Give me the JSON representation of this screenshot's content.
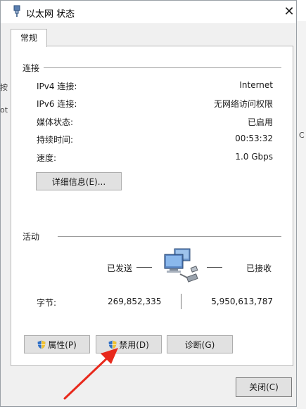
{
  "window": {
    "title": "以太网 状态",
    "close_glyph": "✕"
  },
  "tabs": [
    {
      "label": "常规"
    }
  ],
  "connection": {
    "heading": "连接",
    "rows": [
      {
        "label": "IPv4 连接:",
        "value": "Internet"
      },
      {
        "label": "IPv6 连接:",
        "value": "无网络访问权限"
      },
      {
        "label": "媒体状态:",
        "value": "已启用"
      },
      {
        "label": "持续时间:",
        "value": "00:53:32"
      },
      {
        "label": "速度:",
        "value": "1.0 Gbps"
      }
    ],
    "details_button": "详细信息(E)..."
  },
  "activity": {
    "heading": "活动",
    "sent_label": "已发送",
    "received_label": "已接收",
    "bytes_label": "字节:",
    "bytes_sent": "269,852,335",
    "bytes_received": "5,950,613,787"
  },
  "buttons": {
    "properties": "属性(P)",
    "disable": "禁用(D)",
    "diagnose": "诊断(G)",
    "close": "关闭(C)"
  },
  "background_fragments": {
    "left_a": "按",
    "left_b": "ot",
    "right_a": "C"
  },
  "icons": {
    "title": "network-adapter-icon",
    "network": "network-computers-icon",
    "shield": "uac-shield-icon",
    "annotation": "red-arrow-annotation"
  },
  "colors": {
    "arrow": "#e8291c",
    "shield_blue": "#2f6fc6",
    "shield_yellow": "#f2c230"
  }
}
